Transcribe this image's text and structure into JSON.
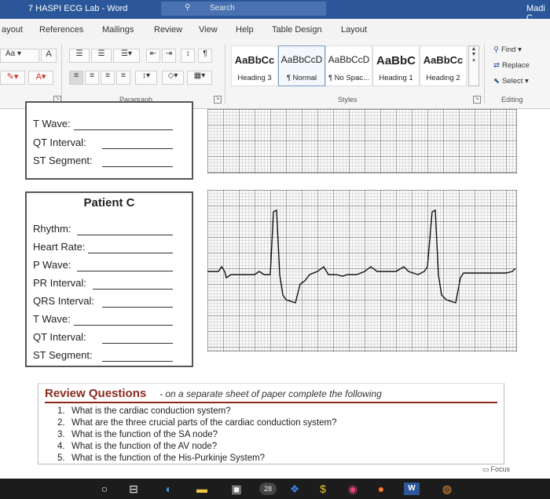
{
  "titlebar": {
    "title": "7 HASPI ECG Lab  -  Word",
    "search_placeholder": "Search",
    "user": "Madi C"
  },
  "tabs": [
    "ayout",
    "References",
    "Mailings",
    "Review",
    "View",
    "Help",
    "Table Design",
    "Layout"
  ],
  "ribbon": {
    "font_size_label": "Aa",
    "paragraph_label": "Paragraph",
    "styles_label": "Styles",
    "editing_label": "Editing",
    "styles": [
      {
        "preview": "AaBbCc",
        "name": "Heading 3"
      },
      {
        "preview": "AaBbCcD",
        "name": "¶ Normal"
      },
      {
        "preview": "AaBbCcD",
        "name": "¶ No Spac..."
      },
      {
        "preview": "AaBbC",
        "name": "Heading 1"
      },
      {
        "preview": "AaBbCc",
        "name": "Heading 2"
      }
    ],
    "editing": {
      "find": "Find",
      "replace": "Replace",
      "select": "Select"
    }
  },
  "patient_b": {
    "fields": [
      "T Wave:",
      "QT Interval:",
      "ST Segment:"
    ]
  },
  "patient_c": {
    "title": "Patient C",
    "fields": [
      "Rhythm:",
      "Heart Rate:",
      "P Wave:",
      "PR Interval:",
      "QRS Interval:",
      "T Wave:",
      "QT Interval:",
      "ST Segment:"
    ]
  },
  "review": {
    "title": "Review Questions",
    "subtitle": "- on a separate sheet of paper complete the following",
    "questions": [
      {
        "n": "1.",
        "text": "What is the cardiac conduction system?"
      },
      {
        "n": "2.",
        "text": "What are the three crucial parts of the cardiac conduction system?"
      },
      {
        "n": "3.",
        "text": "What is the function of the SA node?"
      },
      {
        "n": "4.",
        "text": "What is the function of the AV node?"
      },
      {
        "n": "5.",
        "text": "What is the function of the His-Purkinje System?"
      }
    ]
  },
  "statusbar": {
    "focus": "Focus"
  },
  "taskbar": {
    "badge": "28"
  },
  "colors": {
    "word_blue": "#2b579a",
    "review_title": "#8b2a1f",
    "ecg_grid": "#555555"
  }
}
